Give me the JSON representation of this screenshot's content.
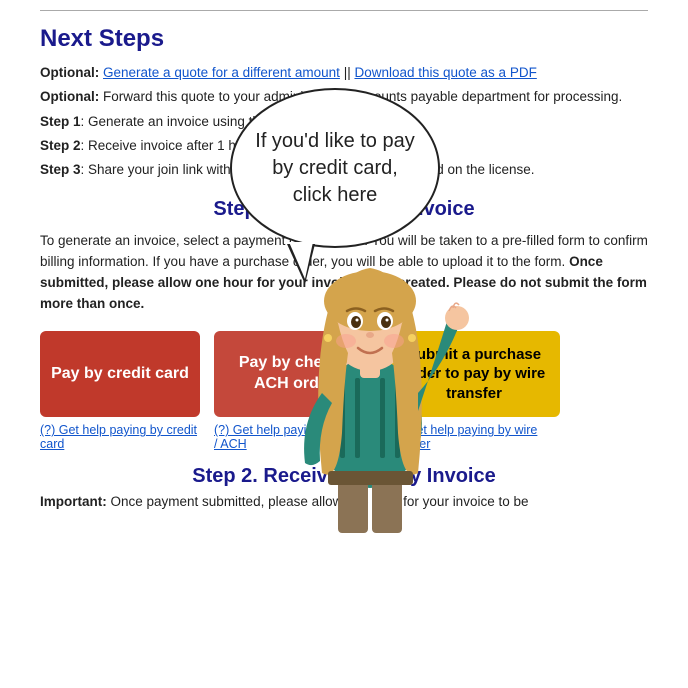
{
  "divider": true,
  "page_title": "Next Steps",
  "optional1": {
    "label": "Optional:",
    "link1_text": "Generate a quote for a different amount",
    "separator": "||",
    "link2_text": "Download this quote as a PDF"
  },
  "optional2": {
    "label": "Optional:",
    "text": "Forward this quote to your administrator / accounts payable department for processing."
  },
  "step1_label": "Step 1",
  "step1_text": ": Generate an invoice using the button below.",
  "step2_label": "Step 2",
  "step2_text": ": Receive invoice after 1 hour.",
  "step3_label": "Step 3",
  "step3_text": ": Share your join link with your team so they can be activated on the license.",
  "section1_title": "Step 1. Generate an Invoice",
  "section1_desc1": "To generate an invoice, select a payment option below. You will be taken to a pre-filled form to confirm billing information. If you have a purchase order, you will be able to upload it to the form. ",
  "section1_desc2": "Once submitted, please allow one hour for your invoice to be created. Please do not submit the form more than once.",
  "btn_credit_card": "Pay by credit card",
  "btn_check": "Pay by check / ACH order",
  "btn_wire": "Submit a purchase order to pay by wire transfer",
  "help_credit_card": "(?) Get help paying by credit card",
  "help_check": "(?) Get help paying by check / ACH",
  "help_wire": "(?) Get help paying by wire transfer",
  "section2_title": "Step 2. Receive and Pay Invoice",
  "section2_desc1": "Important:",
  "section2_desc2": " Once payment submitted, please allow one hour for your invoice to be",
  "speech_bubble_text": "If you'd like to pay by credit card, click here"
}
